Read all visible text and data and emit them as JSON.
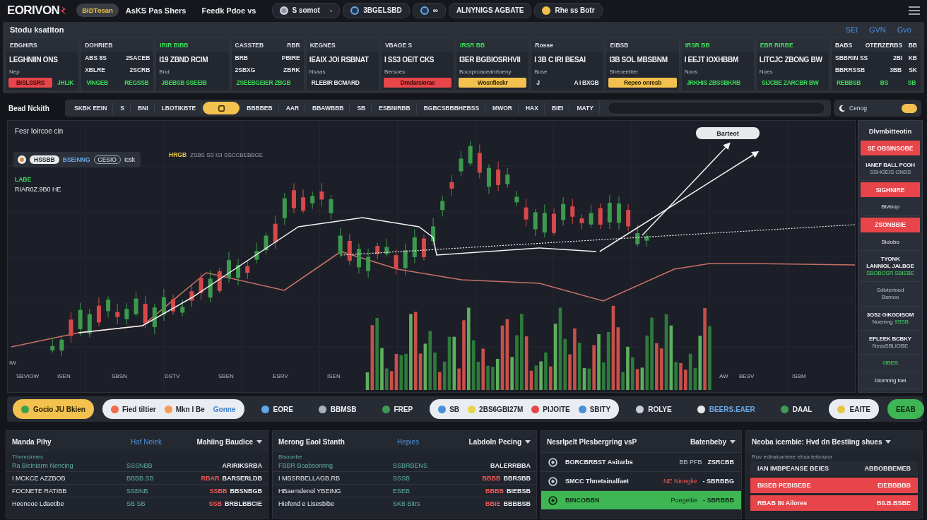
{
  "top_bar": {
    "logo": "EORIVON",
    "badge": "BIDTosan",
    "links": [
      "AsKS Pas Shers",
      "Feedk Pdoe vs"
    ],
    "segments": [
      {
        "kind": "coin",
        "label": "S somot",
        "trail": "-"
      },
      {
        "kind": "ring",
        "label": "3BGELSBD"
      },
      {
        "kind": "ring",
        "label": "∞"
      },
      {
        "kind": "text",
        "label": "ALNYNIGS AGBATE"
      },
      {
        "kind": "dot",
        "label": "Rhe ss Botr"
      }
    ]
  },
  "market": {
    "title": "Stodu ksatiton",
    "links": [
      "SEl",
      "GVN",
      "Gvo"
    ]
  },
  "tickers": [
    {
      "kind": "single",
      "header": "EBGHIRS",
      "highlight": false,
      "value": "LEGHNIIN ONS",
      "sub": "Nep",
      "footer": [
        {
          "text": "BISLSSRS",
          "kind": "red"
        },
        {
          "text": "JHLIK",
          "kind": "green"
        }
      ]
    },
    {
      "kind": "grid",
      "header": "DOHRIEB",
      "highlight": false,
      "rows": [
        [
          "ABS 8S",
          "2SACEB"
        ],
        [
          "XBLRE",
          "2SCRB"
        ]
      ],
      "footer": [
        {
          "text": "VINGEB",
          "kind": "green"
        },
        {
          "text": "REGSSB",
          "kind": "green"
        }
      ]
    },
    {
      "kind": "single",
      "header": "IRIR BIBB",
      "highlight": true,
      "value": "I19 ZBND RCIM",
      "sub": "Bnd",
      "footer": [
        {
          "text": "JBEBSB SSEEIB",
          "kind": "green"
        }
      ]
    },
    {
      "kind": "grid",
      "header": "CASSTEB",
      "header_right": "RBR",
      "highlight": false,
      "rows": [
        [
          "BRB",
          "PBIRE"
        ],
        [
          "2SBXG",
          "ZBRK"
        ]
      ],
      "footer": [
        {
          "text": "ZSEEBGEIER ZBGB",
          "kind": "green"
        }
      ]
    },
    {
      "kind": "single",
      "header": "KEGNES",
      "highlight": false,
      "value": "IEAIX JOI RSBNAT",
      "sub": "Nsaas",
      "footer": [
        {
          "text": "RLEBIR BCMARD",
          "kind": "plain"
        }
      ]
    },
    {
      "kind": "single",
      "header": "VBAOE S",
      "highlight": false,
      "value": "I SS3 OEIT CKS",
      "sub": "Bersoes",
      "footer": [
        {
          "text": "Dmdarsiorac",
          "kind": "red"
        }
      ]
    },
    {
      "kind": "single",
      "header": "IRSR BB",
      "highlight": true,
      "value": "I3ER BGBIOSRHVII",
      "sub": "Bocxprcaoeahrtoeny",
      "footer": [
        {
          "text": "Wosnfieskr",
          "kind": "yellow"
        }
      ]
    },
    {
      "kind": "single",
      "header": "Rosse",
      "highlight": false,
      "value": "I 3B C IRI BESAI",
      "sub": "Buse",
      "footer": [
        {
          "text": "J",
          "kind": "plain"
        },
        {
          "text": "A I BXGB",
          "kind": "plain"
        }
      ]
    },
    {
      "kind": "single",
      "header": "EIBSB",
      "highlight": false,
      "value": "I3B SOL MBSBNM",
      "sub": "Sheoeetiter",
      "footer": [
        {
          "text": "Repeo onresb",
          "kind": "yellow"
        }
      ]
    },
    {
      "kind": "single",
      "header": "IRSR BB",
      "highlight": true,
      "value": "I EEJT IOXHBBM",
      "sub": "Noos",
      "footer": [
        {
          "text": "JRKHIS ZBSSBKRB",
          "kind": "green"
        }
      ]
    },
    {
      "kind": "single",
      "header": "EBR RIRBE",
      "highlight": true,
      "value": "LITCJC ZBONG BW",
      "sub": "Noes",
      "footer": [
        {
          "text": "SIJCBE ZARCBR BW",
          "kind": "green"
        }
      ]
    },
    {
      "kind": "table",
      "header_cells": [
        "BABS",
        "OTERZERBS",
        "BB"
      ],
      "rows": [
        [
          "SBBRIN SS",
          "2BI",
          "KB"
        ],
        [
          "BBRRSSB",
          "3BB",
          "SK"
        ]
      ],
      "footer": [
        {
          "text": "REBBSB",
          "kind": "green"
        },
        {
          "text": "BS",
          "kind": "green"
        },
        {
          "text": "SB",
          "kind": "green"
        }
      ]
    }
  ],
  "toolbar": {
    "label": "Bead Nckith",
    "tabs": [
      {
        "kind": "text",
        "label": "SKBK EEIN",
        "selected": false
      },
      {
        "kind": "text",
        "label": "S",
        "selected": false
      },
      {
        "kind": "text",
        "label": "BNI",
        "selected": false
      },
      {
        "kind": "text",
        "label": "LBOTIKBTE",
        "selected": false
      },
      {
        "kind": "icon",
        "selected": true
      },
      {
        "kind": "text",
        "label": "BBBBEB",
        "selected": false
      },
      {
        "kind": "text",
        "label": "AAR",
        "selected": false
      },
      {
        "kind": "text",
        "label": "BBAWBBB",
        "selected": false
      },
      {
        "kind": "text",
        "label": "SB",
        "selected": false
      },
      {
        "kind": "text",
        "label": "ESBNIRBB",
        "selected": false
      },
      {
        "kind": "text",
        "label": "BGBCSBBBHEBSS",
        "selected": false
      },
      {
        "kind": "text",
        "label": "MWOR",
        "selected": false
      },
      {
        "kind": "text",
        "label": "HAX",
        "selected": false
      },
      {
        "kind": "text",
        "label": "BIEI",
        "selected": false
      },
      {
        "kind": "text",
        "label": "MATY",
        "selected": false
      }
    ],
    "theme_toggle": {
      "label": "Cenog",
      "on": true
    }
  },
  "chart": {
    "title": "Fesr Ioircoe cin",
    "legend": {
      "badge": "HSSBB",
      "link": "BSEINNG",
      "chip": "CESIO",
      "text": "Icsk"
    },
    "note_label": "HRGB",
    "note": "ZSBS SS ISI SSCCBEBBGE",
    "change": "LABE",
    "price": "RIAR0Z.9B0 HE",
    "callout": "Barteot",
    "y_label": "IW",
    "x_axis_labels": [
      "SBVIOW",
      "ISEN",
      "SBSN",
      "DSTV",
      "SBEN",
      "ESRV",
      "ISEN",
      "AW",
      "BESV",
      "ISBM"
    ]
  },
  "side_panel": {
    "title": "Dlvmbitteotin",
    "items": [
      {
        "kind": "alert",
        "text": "SE OBSINSOBE"
      },
      {
        "kind": "entry",
        "lines": [
          {
            "kind": "title",
            "text": "IANEF BALL PCOH"
          },
          {
            "kind": "muted",
            "text": "SSHGEIS GNSS"
          }
        ]
      },
      {
        "kind": "alert",
        "text": "SIGHNIRE"
      },
      {
        "kind": "entry",
        "lines": [
          {
            "kind": "plain",
            "text": "Btvtnop"
          }
        ]
      },
      {
        "kind": "alert",
        "text": "ZSONBBIE"
      },
      {
        "kind": "entry",
        "lines": [
          {
            "kind": "plain",
            "text": "Biciobo"
          }
        ]
      },
      {
        "kind": "entry",
        "lines": [
          {
            "kind": "title",
            "text": "TYONK"
          },
          {
            "kind": "title",
            "text": "LANNIGL JALBGE"
          },
          {
            "kind": "green",
            "text": "SBOBOSR SBIEBE"
          }
        ]
      },
      {
        "kind": "entry",
        "lines": [
          {
            "kind": "muted",
            "text": "Sdivtertoed"
          },
          {
            "kind": "muted",
            "text": "Bsmoo"
          }
        ]
      },
      {
        "kind": "entry",
        "lines": [
          {
            "kind": "title",
            "text": "3OS2 GIKGDISOM"
          },
          {
            "kind": "green",
            "prefix": "Noemng",
            "text": "9SSB"
          }
        ]
      },
      {
        "kind": "entry",
        "lines": [
          {
            "kind": "title",
            "text": "EFLEEK BCBKY"
          },
          {
            "kind": "muted",
            "text": "NessSBLIGBE"
          }
        ]
      },
      {
        "kind": "entry",
        "lines": [
          {
            "kind": "green",
            "text": "0IBEB"
          }
        ]
      },
      {
        "kind": "entry",
        "lines": [
          {
            "kind": "plain",
            "text": "Diomnrig foei"
          }
        ]
      }
    ]
  },
  "action_bar": [
    {
      "kind": "yellow",
      "items": [
        {
          "label": "Gocio JU Bkien",
          "color": "#3aa34a"
        }
      ]
    },
    {
      "kind": "white",
      "items": [
        {
          "label": "Fied tiltier",
          "color": "#f26b4a"
        },
        {
          "label": "Mkn I Be",
          "color": "#f59a55"
        },
        {
          "label": "Gonne",
          "kind": "link"
        }
      ]
    },
    {
      "kind": "plain",
      "items": [
        {
          "label": "EORE",
          "color": "#5fa8e8"
        }
      ]
    },
    {
      "kind": "plain",
      "items": [
        {
          "label": "BBMSB",
          "color": "#aab0bb"
        }
      ]
    },
    {
      "kind": "plain",
      "items": [
        {
          "label": "FREP",
          "color": "#3f9a55"
        }
      ]
    },
    {
      "kind": "white",
      "items": [
        {
          "label": "SB",
          "color": "#4a90d9"
        },
        {
          "label": "2BS6GBI27M",
          "color": "#e8d44a"
        },
        {
          "label": "PIJOITE",
          "color": "#e8454a"
        },
        {
          "label": "SBITY",
          "color": "#4a90d9"
        }
      ]
    },
    {
      "kind": "plain",
      "items": [
        {
          "label": "ROLYE",
          "color": "#c9ced8"
        }
      ]
    },
    {
      "kind": "plain",
      "items": [
        {
          "label": "BEERS.EAER",
          "color": "#e8e8e8",
          "kind": "link"
        }
      ]
    },
    {
      "kind": "plain",
      "items": [
        {
          "label": "DAAL",
          "color": "#3f9a55"
        }
      ]
    },
    {
      "kind": "white",
      "items": [
        {
          "label": "EAITE",
          "color": "#e8c54a"
        }
      ]
    },
    {
      "kind": "green",
      "items": [
        {
          "label": "EEAB"
        }
      ]
    }
  ],
  "bottom_panels": [
    {
      "kind": "table",
      "title": "Manda Pihy",
      "link": "Haf Neiek",
      "dropdown": "Mahiing Baudice",
      "caption": "Thnnrcinnes",
      "head": {
        "name": "Ra Biciniarm Nencing",
        "qty": "SSSNBB",
        "value": "ARIRIKSRBA"
      },
      "rows": [
        {
          "name": "I MCKCE AZZBOB",
          "qty": "BBBB.SB",
          "change": "RBAR",
          "value": "BARSERLDB"
        },
        {
          "name": "FOCNETE RATIBB",
          "qty": "SSBNB",
          "change": "SSBB",
          "value": "BBSNBGB"
        },
        {
          "name": "Heeneoe Ldaetibe",
          "qty": "SB SB",
          "change": "SSB",
          "value": "BRBLBBCIE"
        }
      ]
    },
    {
      "kind": "table",
      "title": "Merong Eaol Stanth",
      "link": "Hepies",
      "dropdown": "Labdoln Pecing",
      "caption": "Bisoonbe",
      "head": {
        "name": "FBBR Boabsonring",
        "qty": "SSBRBENS",
        "value": "BALERRBBA"
      },
      "rows": [
        {
          "name": "I MBSRBELLAGB.RB",
          "qty": "SSSB",
          "change": "BBBB",
          "value": "BBRSBB"
        },
        {
          "name": "HBaemdenol YBEING",
          "qty": "ESEB",
          "change": "BBBB",
          "value": "BIEBSB"
        },
        {
          "name": "Hiefend e Lisesbibe",
          "qty": "SKB Bitrs",
          "change": "BBIE",
          "value": "BBBBSB"
        }
      ]
    },
    {
      "kind": "list",
      "title": "Nesrlpelt Plesbergring vsP",
      "dropdown": "Batenbeby",
      "rows": [
        {
          "name": "BORCBRBST Asitarbs",
          "qty": "BB PFB",
          "value": "ZSRCBB",
          "negative": false,
          "selected": false
        },
        {
          "name": "SMCC Thnetsinalfaet",
          "qty": "NE Nineglie",
          "value": "- SBRBBG",
          "negative": true,
          "selected": false
        },
        {
          "name": "BINCOBBN",
          "qty": "Poegeltie",
          "value": "- SBRBBB",
          "negative": false,
          "selected": true
        }
      ]
    },
    {
      "kind": "alerts",
      "title": "Neoba icembie: Hvd dn Bestiing shues",
      "caption": "Ruv ediraicariene ebsa ieisrazor",
      "rows": [
        {
          "name": "IAN IMBPEANSE BEIES",
          "value": "ABBOBBEMEB",
          "alert": false
        },
        {
          "name": "BISEB PEBISEBE",
          "value": "EIEBBBBB",
          "alert": true
        },
        {
          "name": "RBAB IN Ailores",
          "value": "B0.B.BSBE",
          "alert": true
        }
      ]
    }
  ]
}
